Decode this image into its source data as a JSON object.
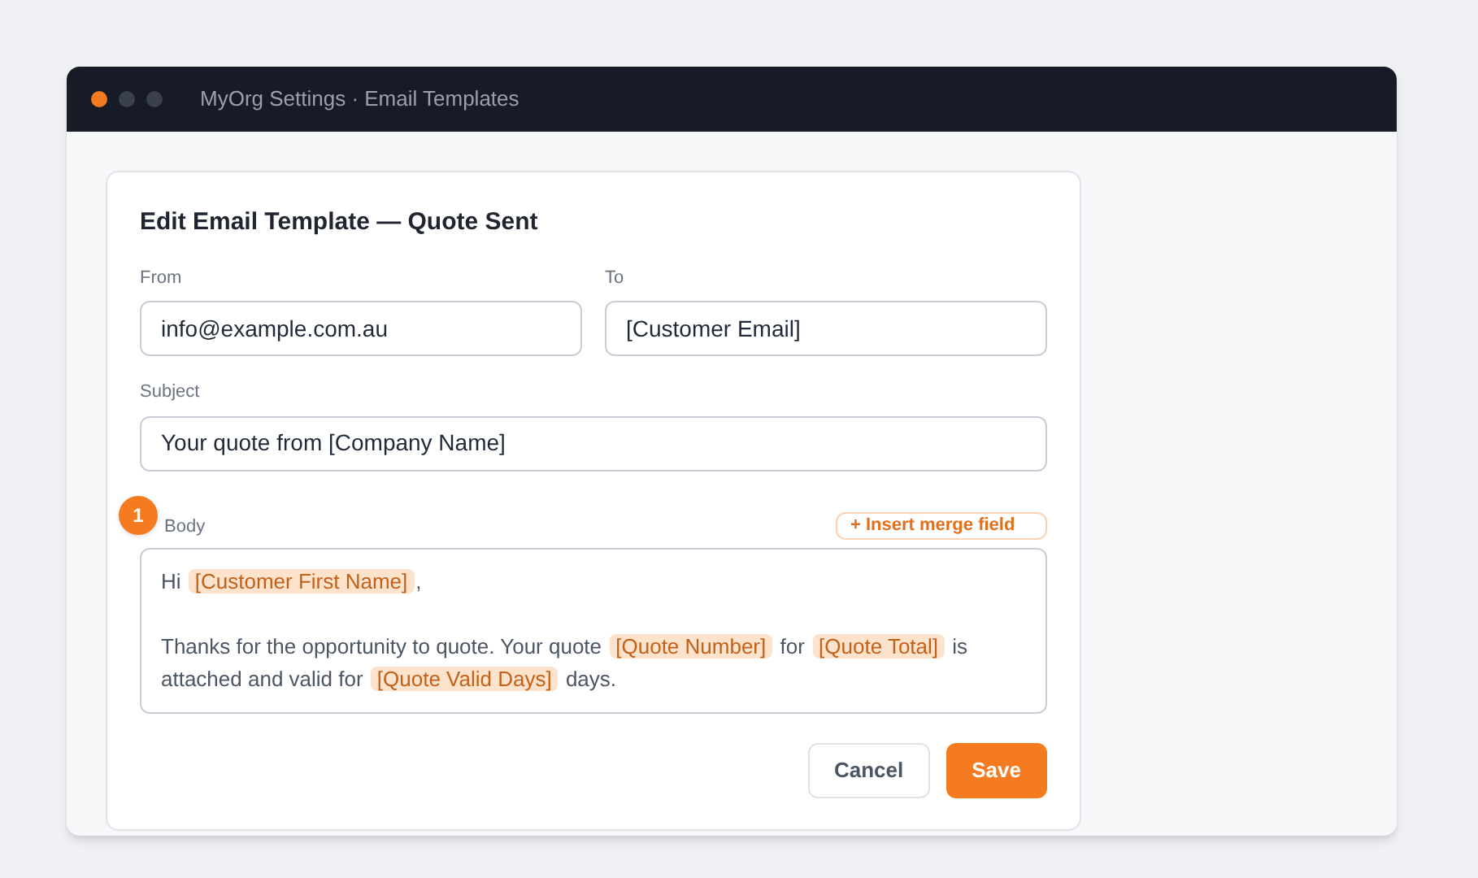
{
  "window": {
    "title": "MyOrg Settings · Email Templates",
    "dots": [
      {
        "color": "#f47b20"
      },
      {
        "color": "#3a404c"
      },
      {
        "color": "#3a404c"
      }
    ]
  },
  "card": {
    "title": "Edit Email Template — Quote Sent"
  },
  "fields": [
    {
      "label": "From",
      "value": "info@example.com.au"
    },
    {
      "label": "To",
      "value": "[Customer Email]"
    }
  ],
  "subject": {
    "label": "Subject",
    "value": "Your quote from [Company Name]"
  },
  "step_badge": "1",
  "body": {
    "label": "Body",
    "insert_button": "+ Insert merge field",
    "paragraphs": [
      [
        {
          "kind": "text",
          "text": "Hi "
        },
        {
          "kind": "merge",
          "text": "[Customer First Name]"
        },
        {
          "kind": "text",
          "text": ","
        }
      ],
      [
        {
          "kind": "text",
          "text": "Thanks for the opportunity to quote. Your quote "
        },
        {
          "kind": "merge",
          "text": "[Quote Number]"
        },
        {
          "kind": "text",
          "text": " for "
        },
        {
          "kind": "merge",
          "text": "[Quote Total]"
        },
        {
          "kind": "text",
          "text": " is attached and valid for "
        },
        {
          "kind": "merge",
          "text": "[Quote Valid Days]"
        },
        {
          "kind": "text",
          "text": " days."
        }
      ]
    ]
  },
  "buttons": [
    {
      "label": "Cancel",
      "kind": "secondary"
    },
    {
      "label": "Save",
      "kind": "primary"
    }
  ]
}
